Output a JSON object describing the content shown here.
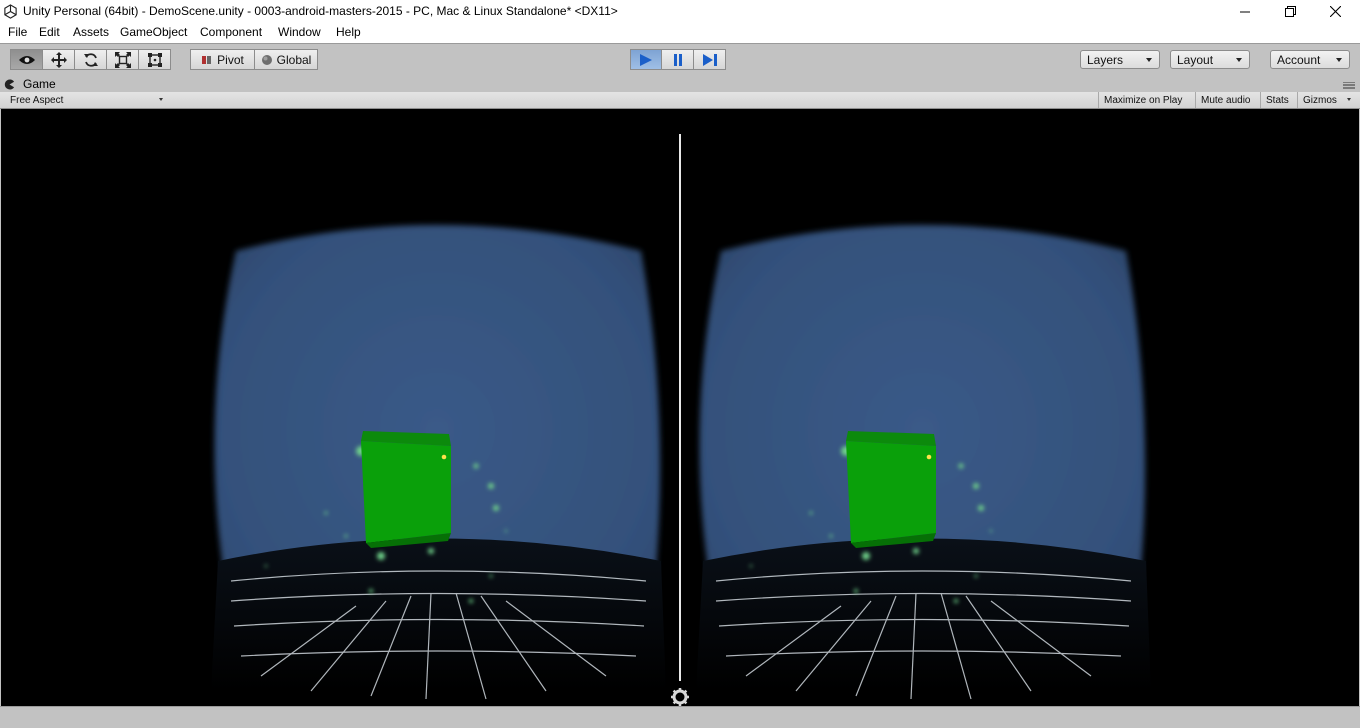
{
  "window": {
    "title": "Unity Personal (64bit) - DemoScene.unity - 0003-android-masters-2015 - PC, Mac & Linux Standalone* <DX11>"
  },
  "menu": [
    "File",
    "Edit",
    "Assets",
    "GameObject",
    "Component",
    "Window",
    "Help"
  ],
  "toolbar": {
    "pivot_label": "Pivot",
    "global_label": "Global",
    "layers_label": "Layers",
    "layout_label": "Layout",
    "account_label": "Account"
  },
  "game_panel": {
    "tab_label": "Game",
    "aspect_label": "Free Aspect",
    "maximize_label": "Maximize on Play",
    "mute_label": "Mute audio",
    "stats_label": "Stats",
    "gizmos_label": "Gizmos"
  },
  "colors": {
    "sky": "#33507a",
    "cube": "#0aa00a",
    "play_active": "#3b74c7"
  }
}
